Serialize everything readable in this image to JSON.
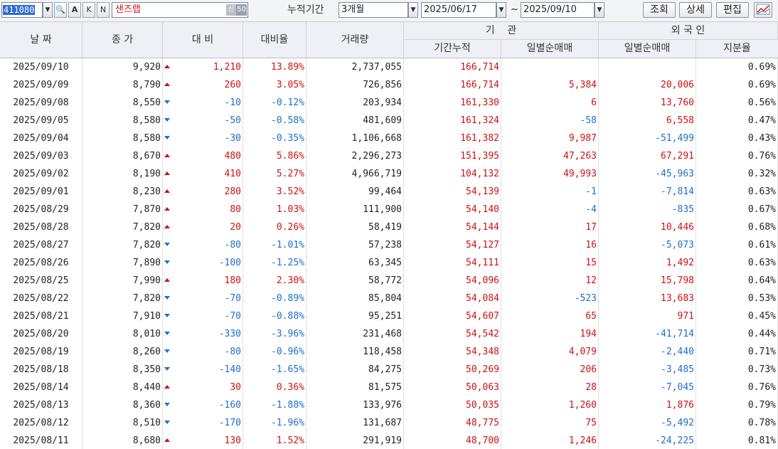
{
  "toolbar": {
    "stock_code": "411080",
    "btn_search": "🔍",
    "btn_a": "A",
    "btn_k": "K",
    "btn_n": "N",
    "stock_name": "샌즈랩",
    "badge_sin": "신",
    "badge_50": "50",
    "period_label": "누적기간",
    "period_value": "3개월",
    "date_from": "2025/06/17",
    "tilde": "~",
    "date_to": "2025/09/10",
    "btn_query": "조회",
    "btn_detail": "상세",
    "btn_edit": "편집"
  },
  "header": {
    "date": "날 짜",
    "close": "종 가",
    "change": "대 비",
    "change_rate": "대비율",
    "volume": "거래량",
    "institution": "기    관",
    "inst_cum": "기간누적",
    "inst_daily": "일별순매매",
    "foreign": "외 국 인",
    "for_daily": "일별순매매",
    "for_share": "지분율"
  },
  "colors": {
    "up": "#d01010",
    "down": "#1d6fc9"
  },
  "rows": [
    {
      "date": "2025/09/10",
      "close": "9,920",
      "dir": "up",
      "change": "1,210",
      "rate": "13.89%",
      "volume": "2,737,055",
      "inst_cum": "166,714",
      "inst_daily": "",
      "for_daily": "",
      "for_share": "0.69%"
    },
    {
      "date": "2025/09/09",
      "close": "8,790",
      "dir": "up",
      "change": "260",
      "rate": "3.05%",
      "volume": "726,856",
      "inst_cum": "166,714",
      "inst_daily": "5,384",
      "for_daily": "20,006",
      "for_share": "0.69%"
    },
    {
      "date": "2025/09/08",
      "close": "8,550",
      "dir": "down",
      "change": "-10",
      "rate": "-0.12%",
      "volume": "203,934",
      "inst_cum": "161,330",
      "inst_daily": "6",
      "for_daily": "13,760",
      "for_share": "0.56%"
    },
    {
      "date": "2025/09/05",
      "close": "8,580",
      "dir": "down",
      "change": "-50",
      "rate": "-0.58%",
      "volume": "481,609",
      "inst_cum": "161,324",
      "inst_daily": "-58",
      "for_daily": "6,558",
      "for_share": "0.47%"
    },
    {
      "date": "2025/09/04",
      "close": "8,580",
      "dir": "down",
      "change": "-30",
      "rate": "-0.35%",
      "volume": "1,106,668",
      "inst_cum": "161,382",
      "inst_daily": "9,987",
      "for_daily": "-51,499",
      "for_share": "0.43%"
    },
    {
      "date": "2025/09/03",
      "close": "8,670",
      "dir": "up",
      "change": "480",
      "rate": "5.86%",
      "volume": "2,296,273",
      "inst_cum": "151,395",
      "inst_daily": "47,263",
      "for_daily": "67,291",
      "for_share": "0.76%"
    },
    {
      "date": "2025/09/02",
      "close": "8,190",
      "dir": "up",
      "change": "410",
      "rate": "5.27%",
      "volume": "4,966,719",
      "inst_cum": "104,132",
      "inst_daily": "49,993",
      "for_daily": "-45,963",
      "for_share": "0.32%"
    },
    {
      "date": "2025/09/01",
      "close": "8,230",
      "dir": "up",
      "change": "280",
      "rate": "3.52%",
      "volume": "99,464",
      "inst_cum": "54,139",
      "inst_daily": "-1",
      "for_daily": "-7,814",
      "for_share": "0.63%"
    },
    {
      "date": "2025/08/29",
      "close": "7,870",
      "dir": "up",
      "change": "80",
      "rate": "1.03%",
      "volume": "111,900",
      "inst_cum": "54,140",
      "inst_daily": "-4",
      "for_daily": "-835",
      "for_share": "0.67%"
    },
    {
      "date": "2025/08/28",
      "close": "7,820",
      "dir": "up",
      "change": "20",
      "rate": "0.26%",
      "volume": "58,419",
      "inst_cum": "54,144",
      "inst_daily": "17",
      "for_daily": "10,446",
      "for_share": "0.68%"
    },
    {
      "date": "2025/08/27",
      "close": "7,820",
      "dir": "down",
      "change": "-80",
      "rate": "-1.01%",
      "volume": "57,238",
      "inst_cum": "54,127",
      "inst_daily": "16",
      "for_daily": "-5,073",
      "for_share": "0.61%"
    },
    {
      "date": "2025/08/26",
      "close": "7,890",
      "dir": "down",
      "change": "-100",
      "rate": "-1.25%",
      "volume": "63,345",
      "inst_cum": "54,111",
      "inst_daily": "15",
      "for_daily": "1,492",
      "for_share": "0.63%"
    },
    {
      "date": "2025/08/25",
      "close": "7,990",
      "dir": "up",
      "change": "180",
      "rate": "2.30%",
      "volume": "58,772",
      "inst_cum": "54,096",
      "inst_daily": "12",
      "for_daily": "15,798",
      "for_share": "0.64%"
    },
    {
      "date": "2025/08/22",
      "close": "7,820",
      "dir": "down",
      "change": "-70",
      "rate": "-0.89%",
      "volume": "85,804",
      "inst_cum": "54,084",
      "inst_daily": "-523",
      "for_daily": "13,683",
      "for_share": "0.53%"
    },
    {
      "date": "2025/08/21",
      "close": "7,910",
      "dir": "down",
      "change": "-70",
      "rate": "-0.88%",
      "volume": "95,251",
      "inst_cum": "54,607",
      "inst_daily": "65",
      "for_daily": "971",
      "for_share": "0.45%"
    },
    {
      "date": "2025/08/20",
      "close": "8,010",
      "dir": "down",
      "change": "-330",
      "rate": "-3.96%",
      "volume": "231,468",
      "inst_cum": "54,542",
      "inst_daily": "194",
      "for_daily": "-41,714",
      "for_share": "0.44%"
    },
    {
      "date": "2025/08/19",
      "close": "8,260",
      "dir": "down",
      "change": "-80",
      "rate": "-0.96%",
      "volume": "118,458",
      "inst_cum": "54,348",
      "inst_daily": "4,079",
      "for_daily": "-2,440",
      "for_share": "0.71%"
    },
    {
      "date": "2025/08/18",
      "close": "8,350",
      "dir": "down",
      "change": "-140",
      "rate": "-1.65%",
      "volume": "84,275",
      "inst_cum": "50,269",
      "inst_daily": "206",
      "for_daily": "-3,485",
      "for_share": "0.73%"
    },
    {
      "date": "2025/08/14",
      "close": "8,440",
      "dir": "up",
      "change": "30",
      "rate": "0.36%",
      "volume": "81,575",
      "inst_cum": "50,063",
      "inst_daily": "28",
      "for_daily": "-7,045",
      "for_share": "0.76%"
    },
    {
      "date": "2025/08/13",
      "close": "8,360",
      "dir": "down",
      "change": "-160",
      "rate": "-1.88%",
      "volume": "133,976",
      "inst_cum": "50,035",
      "inst_daily": "1,260",
      "for_daily": "1,876",
      "for_share": "0.79%"
    },
    {
      "date": "2025/08/12",
      "close": "8,510",
      "dir": "down",
      "change": "-170",
      "rate": "-1.96%",
      "volume": "131,687",
      "inst_cum": "48,775",
      "inst_daily": "75",
      "for_daily": "-5,492",
      "for_share": "0.78%"
    },
    {
      "date": "2025/08/11",
      "close": "8,680",
      "dir": "up",
      "change": "130",
      "rate": "1.52%",
      "volume": "291,919",
      "inst_cum": "48,700",
      "inst_daily": "1,246",
      "for_daily": "-24,225",
      "for_share": "0.81%"
    }
  ]
}
